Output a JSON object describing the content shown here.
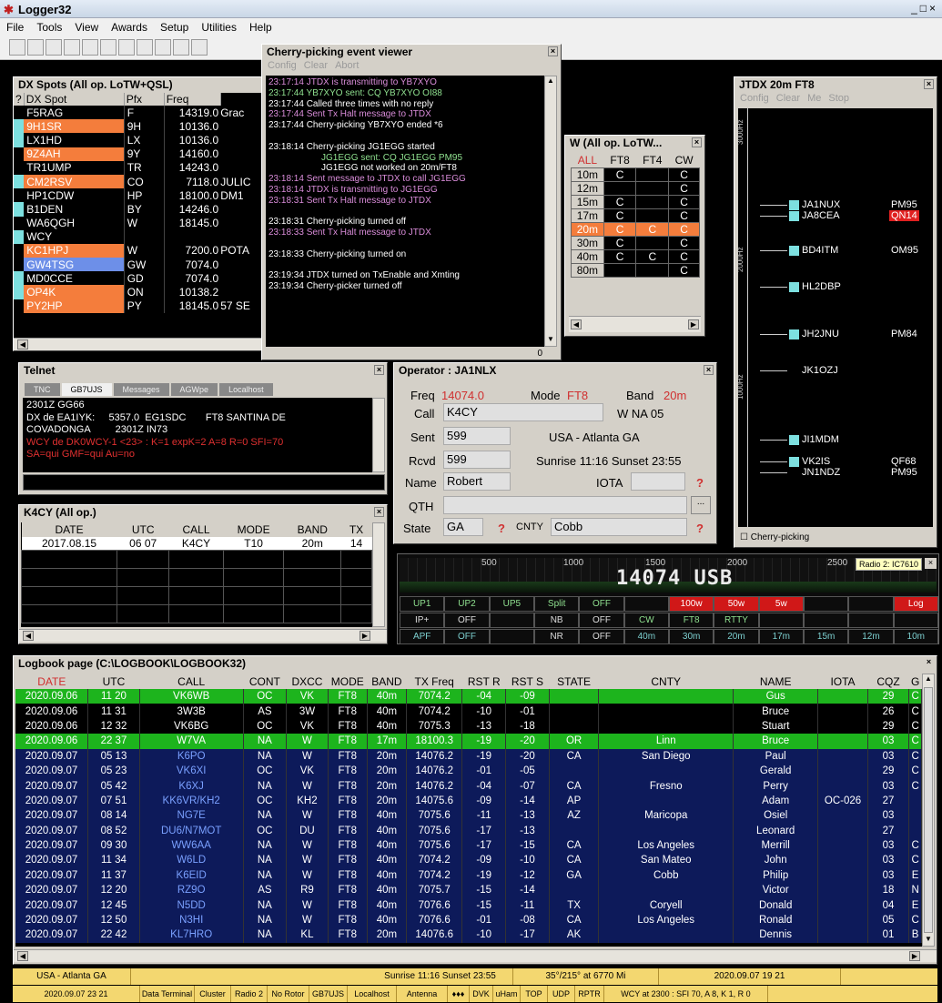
{
  "app": {
    "title": "Logger32",
    "menu": [
      "File",
      "Tools",
      "View",
      "Awards",
      "Setup",
      "Utilities",
      "Help"
    ]
  },
  "dxspots": {
    "title": "DX Spots (All op. LoTW+QSL)",
    "headers": [
      "?",
      "DX Spot",
      "Pfx",
      "Freq"
    ],
    "rows": [
      [
        "F5RAG",
        "F",
        "14319.0",
        "Grac",
        "#000"
      ],
      [
        "9H1SR",
        "9H",
        "10136.0",
        "",
        "#f47d3c"
      ],
      [
        "LX1HD",
        "LX",
        "10136.0",
        "",
        "#000"
      ],
      [
        "9Z4AH",
        "9Y",
        "14160.0",
        "",
        "#f47d3c"
      ],
      [
        "TR1UMP",
        "TR",
        "14243.0",
        "",
        "#000"
      ],
      [
        "CM2RSV",
        "CO",
        "7118.0",
        "JULIC",
        "#f47d3c"
      ],
      [
        "HP1CDW",
        "HP",
        "18100.0",
        "DM1",
        "#000"
      ],
      [
        "B1DEN",
        "BY",
        "14246.0",
        "",
        "#000"
      ],
      [
        "WA6QGH",
        "W",
        "18145.0",
        "",
        "#000"
      ],
      [
        "WCY",
        "",
        "",
        "",
        "#000"
      ],
      [
        "KC1HPJ",
        "W",
        "7200.0",
        "POTA",
        "#f47d3c"
      ],
      [
        "GW4TSG",
        "GW",
        "7074.0",
        "",
        "#6d8fe8"
      ],
      [
        "MD0CCE",
        "GD",
        "7074.0",
        "",
        "#000"
      ],
      [
        "OP4K",
        "ON",
        "10138.2",
        "",
        "#f47d3c"
      ],
      [
        "PY2HP",
        "PY",
        "18145.0",
        "57 SE",
        "#f47d3c"
      ]
    ]
  },
  "cherry": {
    "title": "Cherry-picking event viewer",
    "menu": [
      "Config",
      "Clear",
      "Abort"
    ],
    "count": "0",
    "lines": [
      [
        "23:17:14 JTDX is transmitting to YB7XYO",
        "#d98cd9"
      ],
      [
        "23:17:44 YB7XYO sent: CQ YB7XYO OI88",
        "#8fe08f"
      ],
      [
        "23:17:44 Called three times with no reply",
        "#fff"
      ],
      [
        "23:17:44 Sent Tx Halt message to JTDX",
        "#d98cd9"
      ],
      [
        "23:17:44 Cherry-picking YB7XYO ended *6",
        "#fff"
      ],
      [
        "",
        ""
      ],
      [
        "23:18:14 Cherry-picking JG1EGG started",
        "#fff"
      ],
      [
        "JG1EGG sent: CQ JG1EGG PM95",
        "#8fe08f"
      ],
      [
        "JG1EGG not worked on 20m/FT8",
        "#fff"
      ],
      [
        "23:18:14 Sent message to JTDX to call JG1EGG",
        "#d98cd9"
      ],
      [
        "23:18:14 JTDX is transmitting to JG1EGG",
        "#d98cd9"
      ],
      [
        "23:18:31 Sent Tx Halt message to JTDX",
        "#d98cd9"
      ],
      [
        "",
        ""
      ],
      [
        "23:18:31 Cherry-picking turned off",
        "#fff"
      ],
      [
        "23:18:33 Sent Tx Halt message to JTDX",
        "#d98cd9"
      ],
      [
        "",
        ""
      ],
      [
        "23:18:33 Cherry-picking turned on",
        "#fff"
      ],
      [
        "",
        ""
      ],
      [
        "23:19:34 JTDX turned on TxEnable and Xmting",
        "#fff"
      ],
      [
        "23:19:34 Cherry-picker turned off",
        "#fff"
      ]
    ]
  },
  "wpanel": {
    "title": "W (All op. LoTW...",
    "headers": [
      "ALL",
      "FT8",
      "FT4",
      "CW"
    ],
    "rows": [
      [
        "10m",
        "C",
        "",
        "C"
      ],
      [
        "12m",
        "",
        "",
        "C"
      ],
      [
        "15m",
        "C",
        "",
        "C"
      ],
      [
        "17m",
        "C",
        "",
        "C"
      ],
      [
        "20m",
        "C",
        "C",
        "C"
      ],
      [
        "30m",
        "C",
        "",
        "C"
      ],
      [
        "40m",
        "C",
        "C",
        "C"
      ],
      [
        "80m",
        "",
        "",
        "C"
      ]
    ]
  },
  "jtdx": {
    "title": "JTDX  20m  FT8",
    "menu": [
      "Config",
      "Clear",
      "Me",
      "Stop"
    ],
    "checkbox": "Cherry-picking",
    "freqs": [
      "3000Hz",
      "2000Hz",
      "1000Hz"
    ],
    "calls": [
      [
        "JA1NUX",
        "PM95",
        true,
        false
      ],
      [
        "JA8CEA",
        "QN14",
        true,
        true
      ],
      [
        "BD4ITM",
        "OM95",
        true,
        false
      ],
      [
        "HL2DBP",
        "",
        true,
        false
      ],
      [
        "JH2JNU",
        "PM84",
        true,
        false
      ],
      [
        "JK1OZJ",
        "",
        false,
        false
      ],
      [
        "JI1MDM",
        "",
        true,
        false
      ],
      [
        "VK2IS",
        "QF68",
        true,
        false
      ],
      [
        "JN1NDZ",
        "PM95",
        false,
        false
      ]
    ]
  },
  "telnet": {
    "title": "Telnet",
    "tabs": [
      "TNC",
      "GB7UJS",
      "Messages",
      "AGWpe",
      "Localhost"
    ],
    "lines": [
      [
        "2301Z GG66",
        "#fff"
      ],
      [
        "DX de EA1IYK:     5357.0  EG1SDC       FT8 SANTINA DE",
        "#fff"
      ],
      [
        "COVADONGA         2301Z IN73",
        "#fff"
      ],
      [
        "WCY de DK0WCY-1 <23> : K=1 expK=2 A=8 R=0 SFI=70",
        "#e03030"
      ],
      [
        "SA=qui GMF=qui Au=no",
        "#e03030"
      ]
    ]
  },
  "k4cy": {
    "title": "K4CY (All op.)",
    "headers": [
      "DATE",
      "UTC",
      "CALL",
      "MODE",
      "BAND",
      "TX"
    ],
    "row": [
      "2017.08.15",
      "06 07",
      "K4CY",
      "T10",
      "20m",
      "14"
    ]
  },
  "operator": {
    "title": "Operator : JA1NLX",
    "freq_label": "Freq",
    "freq": "14074.0",
    "mode_label": "Mode",
    "mode": "FT8",
    "band_label": "Band",
    "band": "20m",
    "call_label": "Call",
    "call": "K4CY",
    "region": "W NA 05",
    "sent_label": "Sent",
    "sent": "599",
    "location": "USA - Atlanta GA",
    "rcvd_label": "Rcvd",
    "rcvd": "599",
    "sun": "Sunrise 11:16 Sunset 23:55",
    "name_label": "Name",
    "name": "Robert",
    "iota_label": "IOTA",
    "qth_label": "QTH",
    "qth": "",
    "state_label": "State",
    "state": "GA",
    "cnty_label": "CNTY",
    "cnty": "Cobb",
    "q": "?",
    "dots": "..."
  },
  "radio": {
    "title": "Radio 2: IC7610",
    "scale": [
      "500",
      "1000",
      "1500",
      "2000",
      "2500"
    ],
    "freq": "14074 USB",
    "row1": [
      [
        "UP1",
        "g"
      ],
      [
        "UP2",
        "g"
      ],
      [
        "UP5",
        "g"
      ],
      [
        "Split",
        "g"
      ],
      [
        "OFF",
        "g"
      ],
      [
        "",
        ""
      ],
      [
        "100w",
        "r"
      ],
      [
        "50w",
        "r"
      ],
      [
        "5w",
        "r"
      ],
      [
        "",
        ""
      ],
      [
        "",
        ""
      ],
      [
        "Log",
        "r"
      ]
    ],
    "row2": [
      [
        "IP+",
        "w"
      ],
      [
        "OFF",
        "w"
      ],
      [
        "",
        ""
      ],
      [
        "NB",
        "w"
      ],
      [
        "OFF",
        "w"
      ],
      [
        "CW",
        "g"
      ],
      [
        "FT8",
        "g"
      ],
      [
        "RTTY",
        "g"
      ],
      [
        "",
        ""
      ],
      [
        "",
        ""
      ],
      [
        "",
        ""
      ],
      [
        "",
        ""
      ]
    ],
    "row3": [
      [
        "APF",
        "c"
      ],
      [
        "OFF",
        "c"
      ],
      [
        "",
        ""
      ],
      [
        "NR",
        "w"
      ],
      [
        "OFF",
        "w"
      ],
      [
        "40m",
        "c"
      ],
      [
        "30m",
        "c"
      ],
      [
        "20m",
        "c"
      ],
      [
        "17m",
        "c"
      ],
      [
        "15m",
        "c"
      ],
      [
        "12m",
        "c"
      ],
      [
        "10m",
        "c"
      ]
    ]
  },
  "logbook": {
    "title": "Logbook page (C:\\LOGBOOK\\LOGBOOK32)",
    "headers": [
      "DATE",
      "UTC",
      "CALL",
      "CONT",
      "DXCC",
      "MODE",
      "BAND",
      "TX Freq",
      "RST R",
      "RST S",
      "STATE",
      "CNTY",
      "NAME",
      "IOTA",
      "CQZ",
      "G"
    ],
    "rows": [
      [
        "2020.09.06",
        "11 20",
        "VK6WB",
        "OC",
        "VK",
        "FT8",
        "40m",
        "7074.2",
        "-04",
        "-09",
        "",
        "",
        "Gus",
        "",
        "29",
        "C",
        "g"
      ],
      [
        "2020.09.06",
        "11 31",
        "3W3B",
        "AS",
        "3W",
        "FT8",
        "40m",
        "7074.2",
        "-10",
        "-01",
        "",
        "",
        "Bruce",
        "",
        "26",
        "C",
        "k"
      ],
      [
        "2020.09.06",
        "12 32",
        "VK6BG",
        "OC",
        "VK",
        "FT8",
        "40m",
        "7075.3",
        "-13",
        "-18",
        "",
        "",
        "Stuart",
        "",
        "29",
        "C",
        "k"
      ],
      [
        "2020.09.06",
        "22 37",
        "W7VA",
        "NA",
        "W",
        "FT8",
        "17m",
        "18100.3",
        "-19",
        "-20",
        "OR",
        "Linn",
        "Bruce",
        "",
        "03",
        "C",
        "g"
      ],
      [
        "2020.09.07",
        "05 13",
        "K6PO",
        "NA",
        "W",
        "FT8",
        "20m",
        "14076.2",
        "-19",
        "-20",
        "CA",
        "San Diego",
        "Paul",
        "",
        "03",
        "C",
        "b"
      ],
      [
        "2020.09.07",
        "05 23",
        "VK6XI",
        "OC",
        "VK",
        "FT8",
        "20m",
        "14076.2",
        "-01",
        "-05",
        "",
        "",
        "Gerald",
        "",
        "29",
        "C",
        "b"
      ],
      [
        "2020.09.07",
        "05 42",
        "K6XJ",
        "NA",
        "W",
        "FT8",
        "20m",
        "14076.2",
        "-04",
        "-07",
        "CA",
        "Fresno",
        "Perry",
        "",
        "03",
        "C",
        "b"
      ],
      [
        "2020.09.07",
        "07 51",
        "KK6VR/KH2",
        "OC",
        "KH2",
        "FT8",
        "20m",
        "14075.6",
        "-09",
        "-14",
        "AP",
        "",
        "Adam",
        "OC-026",
        "27",
        "",
        "b"
      ],
      [
        "2020.09.07",
        "08 14",
        "NG7E",
        "NA",
        "W",
        "FT8",
        "40m",
        "7075.6",
        "-11",
        "-13",
        "AZ",
        "Maricopa",
        "Osiel",
        "",
        "03",
        "",
        "b"
      ],
      [
        "2020.09.07",
        "08 52",
        "DU6/N7MOT",
        "OC",
        "DU",
        "FT8",
        "40m",
        "7075.6",
        "-17",
        "-13",
        "",
        "",
        "Leonard",
        "",
        "27",
        "",
        "b"
      ],
      [
        "2020.09.07",
        "09 30",
        "WW6AA",
        "NA",
        "W",
        "FT8",
        "40m",
        "7075.6",
        "-17",
        "-15",
        "CA",
        "Los Angeles",
        "Merrill",
        "",
        "03",
        "C",
        "b"
      ],
      [
        "2020.09.07",
        "11 34",
        "W6LD",
        "NA",
        "W",
        "FT8",
        "40m",
        "7074.2",
        "-09",
        "-10",
        "CA",
        "San Mateo",
        "John",
        "",
        "03",
        "C",
        "b"
      ],
      [
        "2020.09.07",
        "11 37",
        "K6EID",
        "NA",
        "W",
        "FT8",
        "40m",
        "7074.2",
        "-19",
        "-12",
        "GA",
        "Cobb",
        "Philip",
        "",
        "03",
        "E",
        "b"
      ],
      [
        "2020.09.07",
        "12 20",
        "RZ9O",
        "AS",
        "R9",
        "FT8",
        "40m",
        "7075.7",
        "-15",
        "-14",
        "",
        "",
        "Victor",
        "",
        "18",
        "N",
        "b"
      ],
      [
        "2020.09.07",
        "12 45",
        "N5DD",
        "NA",
        "W",
        "FT8",
        "40m",
        "7076.6",
        "-15",
        "-11",
        "TX",
        "Coryell",
        "Donald",
        "",
        "04",
        "E",
        "b"
      ],
      [
        "2020.09.07",
        "12 50",
        "N3HI",
        "NA",
        "W",
        "FT8",
        "40m",
        "7076.6",
        "-01",
        "-08",
        "CA",
        "Los Angeles",
        "Ronald",
        "",
        "05",
        "C",
        "b"
      ],
      [
        "2020.09.07",
        "22 42",
        "KL7HRO",
        "NA",
        "KL",
        "FT8",
        "20m",
        "14076.6",
        "-10",
        "-17",
        "AK",
        "",
        "Dennis",
        "",
        "01",
        "B",
        "b"
      ]
    ]
  },
  "status1": [
    "USA - Atlanta GA",
    "",
    "Sunrise 11:16 Sunset 23:55",
    "35°/215° at 6770 Mi",
    "2020.09.07  19 21"
  ],
  "status2": [
    "2020.09.07  23 21",
    "Data Terminal",
    "Cluster",
    "Radio 2",
    "No Rotor",
    "GB7UJS",
    "Localhost",
    "Antenna",
    "♦♦♦",
    "DVK",
    "uHam",
    "TOP",
    "UDP",
    "RPTR",
    "WCY at 2300 : SFI 70, A 8, K 1, R 0"
  ]
}
